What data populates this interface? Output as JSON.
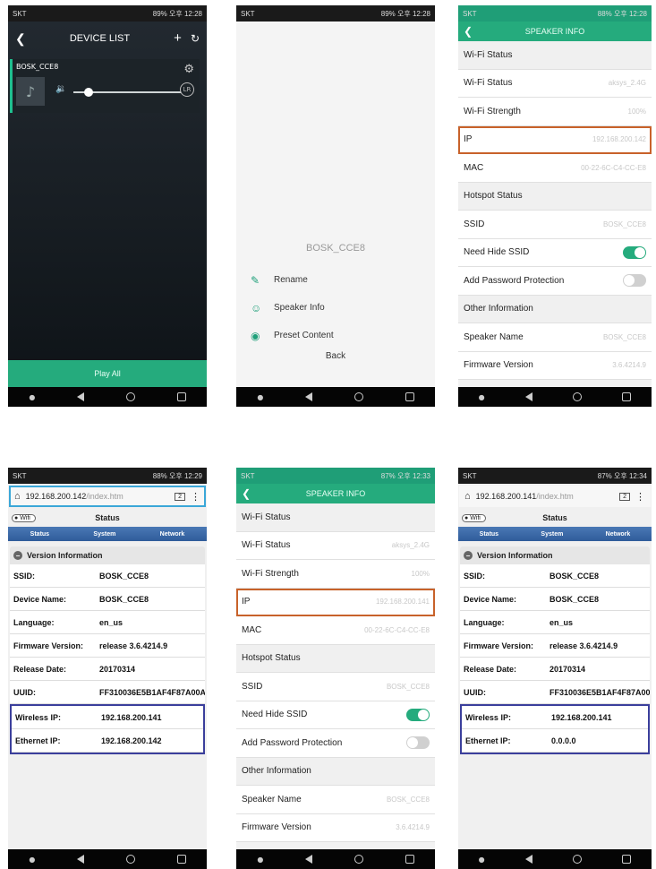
{
  "status": {
    "carrier": "SKT",
    "p1": {
      "battery": "89%",
      "time": "오후 12:28"
    },
    "p2": {
      "battery": "89%",
      "time": "오후 12:28"
    },
    "p3": {
      "battery": "88%",
      "time": "오후 12:28"
    },
    "p4": {
      "battery": "88%",
      "time": "오후 12:29"
    },
    "p5": {
      "battery": "87%",
      "time": "오후 12:33"
    },
    "p6": {
      "battery": "87%",
      "time": "오후 12:34"
    }
  },
  "device_list": {
    "title": "DEVICE LIST",
    "device_name": "BOSK_CCE8",
    "volume_level": 0.14,
    "lr_label": "LR",
    "play_all": "Play All"
  },
  "device_menu": {
    "device_name": "BOSK_CCE8",
    "items": [
      "Rename",
      "Speaker Info",
      "Preset Content"
    ],
    "back": "Back"
  },
  "speaker_info": {
    "title": "SPEAKER INFO",
    "rows": [
      {
        "label": "Wi-Fi Status",
        "value": "",
        "kind": "section"
      },
      {
        "label": "Wi-Fi Status",
        "value": "aksys_2.4G",
        "kind": "value"
      },
      {
        "label": "Wi-Fi Strength",
        "value": "100%",
        "kind": "value"
      },
      {
        "label": "IP",
        "value": "192.168.200.141",
        "kind": "value",
        "highlight": true
      },
      {
        "label": "MAC",
        "value": "00-22-6C-C4-CC-E8",
        "kind": "value"
      },
      {
        "label": "Hotspot Status",
        "value": "",
        "kind": "section"
      },
      {
        "label": "SSID",
        "value": "BOSK_CCE8",
        "kind": "value"
      },
      {
        "label": "Need Hide SSID",
        "value": "",
        "kind": "toggle-on"
      },
      {
        "label": "Add Password Protection",
        "value": "",
        "kind": "toggle-off"
      },
      {
        "label": "Other Information",
        "value": "",
        "kind": "section"
      },
      {
        "label": "Speaker Name",
        "value": "BOSK_CCE8",
        "kind": "value"
      },
      {
        "label": "Firmware Version",
        "value": "3.6.4214.9",
        "kind": "value"
      }
    ],
    "ip_p3": "192.168.200.142"
  },
  "web": {
    "p4_host": "192.168.200.142",
    "p6_host": "192.168.200.141",
    "path": "/index.htm",
    "tab_count": "2",
    "wifi_btn": "Wifi",
    "title": "Status",
    "tabs": [
      "Status",
      "System",
      "Network"
    ],
    "section": "Version Information",
    "rows": [
      {
        "k": "SSID:",
        "v": "BOSK_CCE8"
      },
      {
        "k": "Device Name:",
        "v": "BOSK_CCE8"
      },
      {
        "k": "Language:",
        "v": "en_us"
      },
      {
        "k": "Firmware Version:",
        "v": "release 3.6.4214.9"
      },
      {
        "k": "Release Date:",
        "v": "20170314"
      },
      {
        "k": "UUID:",
        "v": "FF310036E5B1AF4F87A00A"
      }
    ],
    "p4_ip": [
      {
        "k": "Wireless IP:",
        "v": "192.168.200.141"
      },
      {
        "k": "Ethernet IP:",
        "v": "192.168.200.142"
      }
    ],
    "p6_ip": [
      {
        "k": "Wireless IP:",
        "v": "192.168.200.141"
      },
      {
        "k": "Ethernet IP:",
        "v": "0.0.0.0"
      }
    ]
  },
  "colors": {
    "accent": "#25ab7d",
    "highlight_orange": "#c8622a",
    "highlight_blue": "#3b3f9c",
    "url_border": "#3aa7d8"
  }
}
